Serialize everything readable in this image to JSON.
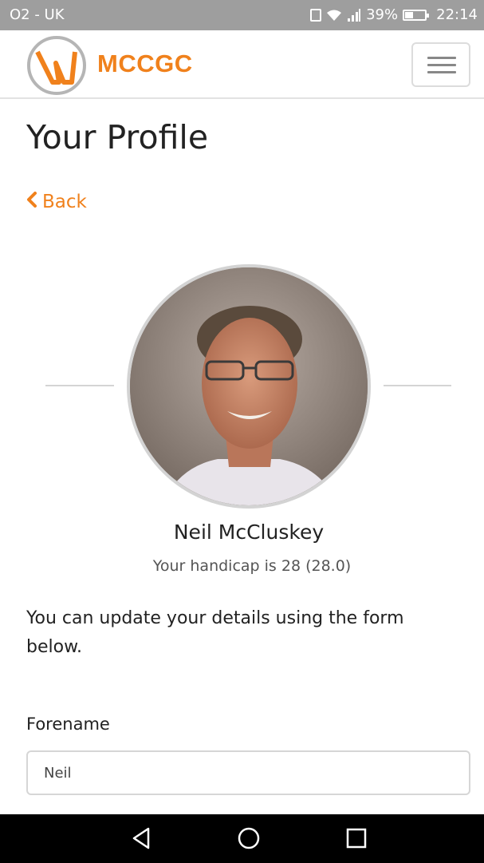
{
  "status_bar": {
    "carrier": "O2 - UK",
    "battery": "39%",
    "time": "22:14"
  },
  "header": {
    "brand": "MCCGC",
    "logo_icon": "mccgc-logo",
    "menu_icon": "hamburger-menu-icon"
  },
  "page": {
    "title": "Your Profile",
    "back_label": "Back"
  },
  "profile": {
    "name": "Neil McCluskey",
    "handicap_text": "Your handicap is 28 (28.0)",
    "intro": "You can update your details using the form below."
  },
  "form": {
    "forename_label": "Forename",
    "forename_value": "Neil"
  },
  "colors": {
    "accent": "#f0811c",
    "status_bar": "#9e9e9e",
    "android_nav": "#000000"
  }
}
